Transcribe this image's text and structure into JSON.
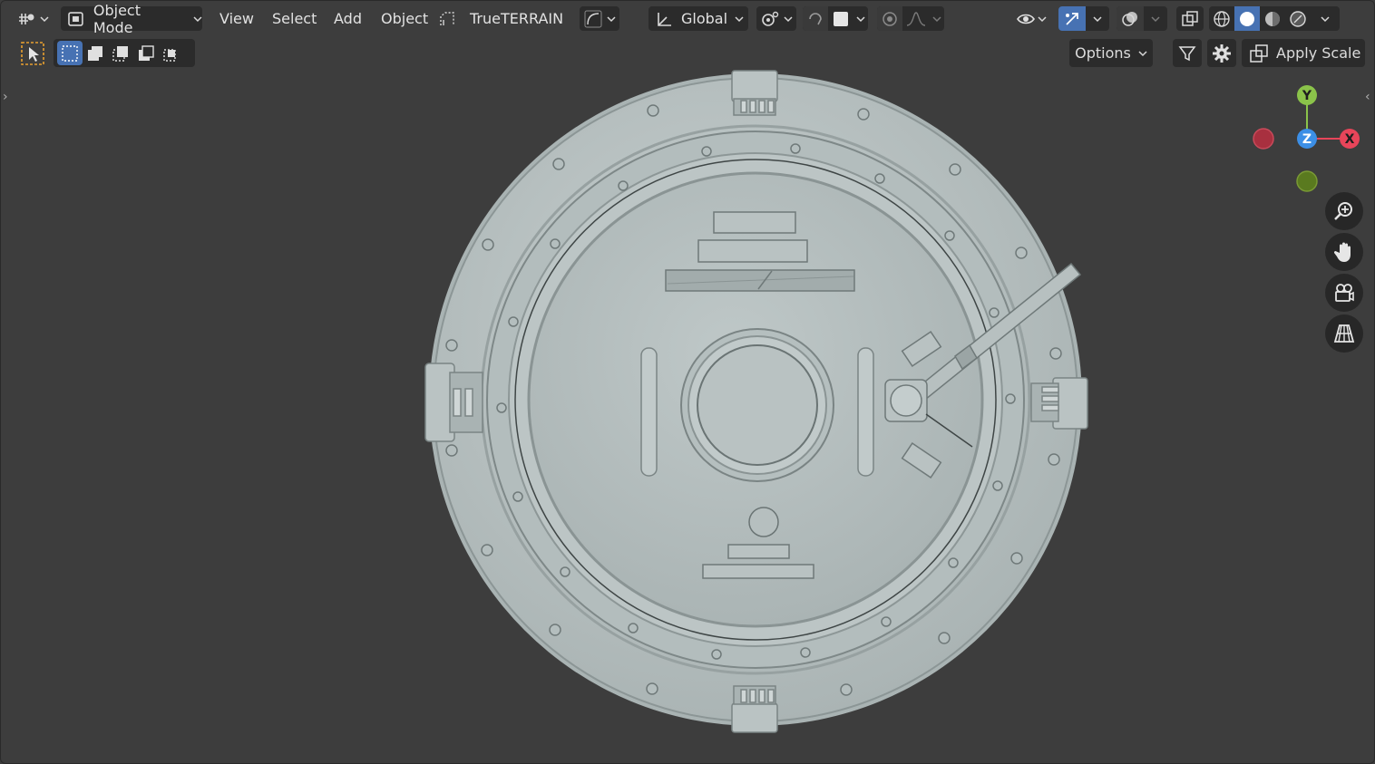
{
  "header": {
    "editor_type_icon": "editor-type-icon",
    "mode": {
      "label": "Object Mode",
      "icon": "object-mode-icon"
    },
    "menus": [
      "View",
      "Select",
      "Add",
      "Object"
    ],
    "addon": {
      "label": "TrueTERRAIN",
      "icon": "trueterrain-icon"
    },
    "transform_orientation": "Global",
    "pivot_icon": "pivot-icon",
    "snap_icon": "magnet-icon",
    "proportional_icon": "proportional-edit-icon",
    "visibility_icon": "eye-icon",
    "gizmo_icon": "gizmo-icon",
    "overlay_icon": "overlay-icon",
    "xray_icon": "xray-icon",
    "shading_modes": [
      "wireframe",
      "solid",
      "material-preview",
      "rendered"
    ],
    "active_shading": "solid"
  },
  "toolbar": {
    "options_label": "Options",
    "apply_scale_label": "Apply Scale",
    "select_modes": [
      "new",
      "extend",
      "subtract",
      "invert",
      "intersect"
    ]
  },
  "gizmo": {
    "axes": [
      {
        "label": "Y",
        "color": "#8bc34a"
      },
      {
        "label": "X",
        "color": "#e8455a"
      },
      {
        "label": "Z",
        "color": "#3c8fe6"
      }
    ],
    "neg_x_color": "#a8303f",
    "neg_y_color": "#5a7a1f"
  },
  "nav_buttons": [
    "zoom-icon",
    "hand-pan-icon",
    "camera-icon",
    "perspective-grid-icon"
  ],
  "colors": {
    "viewport_bg": "#3d3d3d",
    "header_bg": "#2b2b2b",
    "accent": "#4772b3",
    "mesh": "#b8c2c2"
  }
}
